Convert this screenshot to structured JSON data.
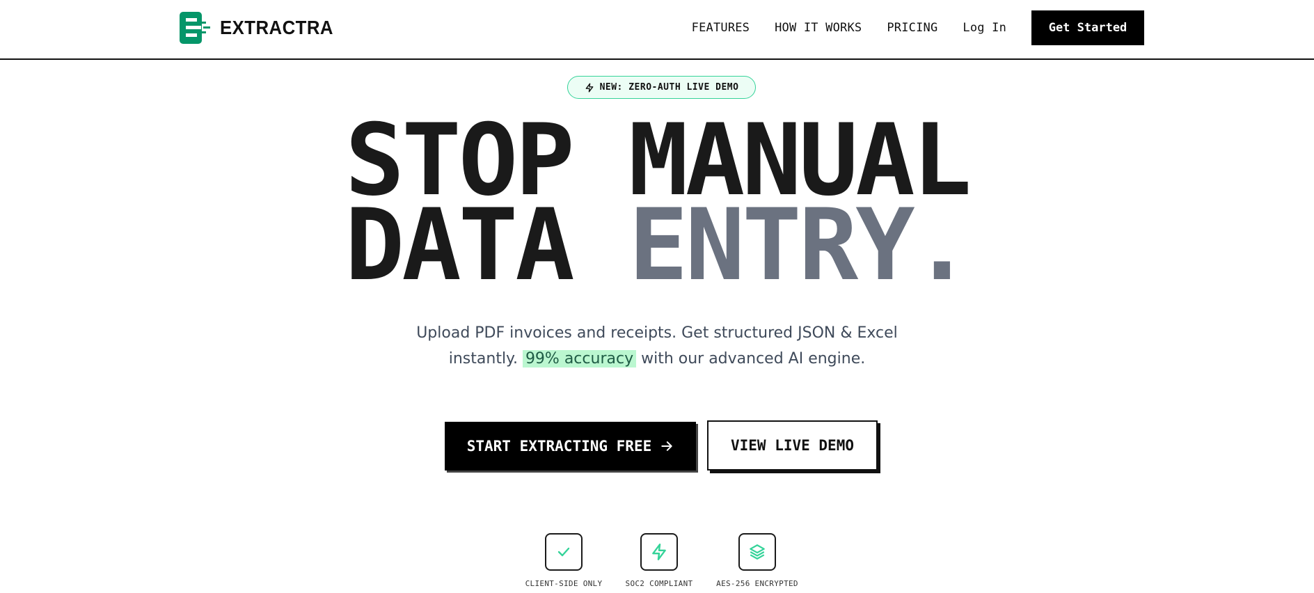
{
  "brand": {
    "name": "EXTRACTRA",
    "accent": "#059669",
    "accent_light": "#34d399"
  },
  "nav": {
    "links": [
      "FEATURES",
      "HOW IT WORKS",
      "PRICING",
      "Log In"
    ],
    "cta": "Get Started"
  },
  "badge": {
    "icon": "lightning-icon",
    "label": "NEW: ZERO-AUTH LIVE DEMO"
  },
  "hero": {
    "line1": "STOP MANUAL",
    "line2_a": "DATA ",
    "line2_b": "ENTRY.",
    "subtext_1": "Upload PDF invoices and receipts. Get structured JSON & Excel instantly.",
    "subtext_highlight": "99% accuracy",
    "subtext_2": " with our advanced AI engine."
  },
  "cta": {
    "primary": "START EXTRACTING FREE",
    "primary_icon": "arrow-right-icon",
    "secondary": "VIEW LIVE DEMO"
  },
  "trust": [
    {
      "icon": "check-icon",
      "label": "CLIENT-SIDE ONLY"
    },
    {
      "icon": "lightning-icon",
      "label": "SOC2 COMPLIANT"
    },
    {
      "icon": "layers-icon",
      "label": "AES-256 ENCRYPTED"
    }
  ]
}
